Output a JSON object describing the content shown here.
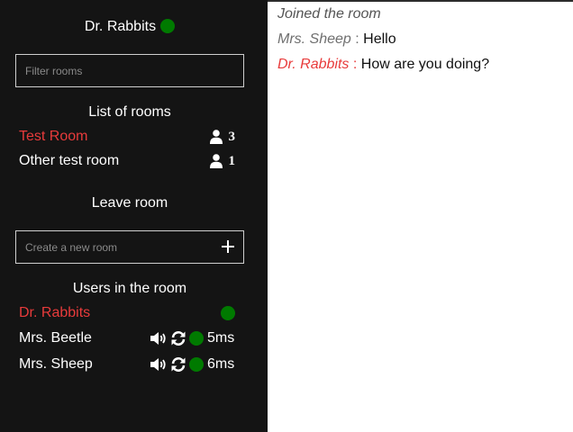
{
  "sidebar": {
    "current_user": {
      "name": "Dr. Rabbits",
      "status_color": "#007a00"
    },
    "filter": {
      "placeholder": "Filter rooms",
      "value": ""
    },
    "rooms_title": "List of rooms",
    "rooms": [
      {
        "name": "Test Room",
        "count": "3",
        "active": true
      },
      {
        "name": "Other test room",
        "count": "1",
        "active": false
      }
    ],
    "leave_room_label": "Leave room",
    "create_room": {
      "placeholder": "Create a new room",
      "value": ""
    },
    "users_title": "Users in the room",
    "users": [
      {
        "name": "Dr. Rabbits",
        "self": true,
        "ping": ""
      },
      {
        "name": "Mrs. Beetle",
        "self": false,
        "ping": "5ms"
      },
      {
        "name": "Mrs. Sheep",
        "self": false,
        "ping": "6ms"
      }
    ],
    "icons": {
      "user": "user-icon",
      "speaker": "speaker-icon",
      "sync": "sync-icon",
      "add": "plus-icon"
    }
  },
  "chat": {
    "system_message": "Joined the room",
    "messages": [
      {
        "author": "Mrs. Sheep",
        "separator": " : ",
        "text": "Hello"
      },
      {
        "author": "Dr. Rabbits",
        "separator": " : ",
        "text": "How are you doing?"
      }
    ]
  },
  "colors": {
    "sidebar_bg": "#141414",
    "accent_red": "#e83b3b",
    "online_green": "#007a00",
    "text_white": "#ffffff"
  }
}
